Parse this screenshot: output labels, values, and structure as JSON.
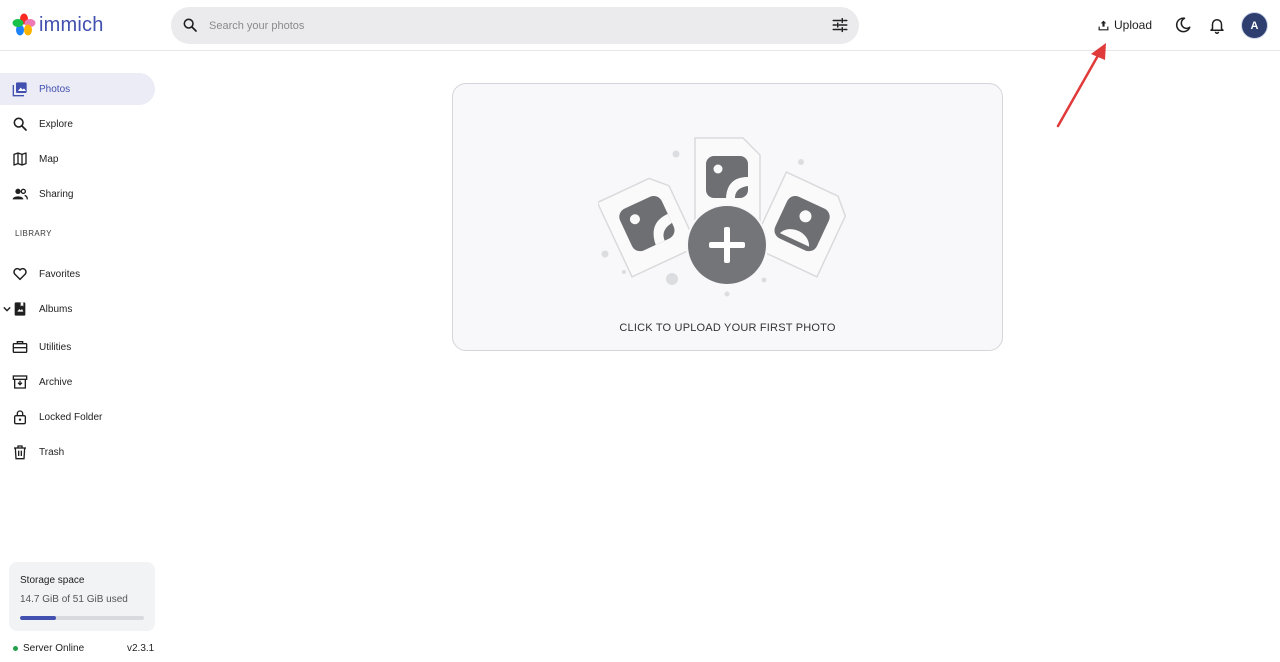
{
  "app": {
    "name": "immich",
    "brand_color": "#4250af"
  },
  "search": {
    "placeholder": "Search your photos"
  },
  "header": {
    "upload_label": "Upload",
    "avatar_initial": "A"
  },
  "sidebar": {
    "items": [
      {
        "label": "Photos",
        "icon": "photos-icon",
        "active": true
      },
      {
        "label": "Explore",
        "icon": "search-icon"
      },
      {
        "label": "Map",
        "icon": "map-icon"
      },
      {
        "label": "Sharing",
        "icon": "people-icon"
      }
    ],
    "library_label": "LIBRARY",
    "library_items": [
      {
        "label": "Favorites",
        "icon": "heart-icon"
      },
      {
        "label": "Albums",
        "icon": "album-icon",
        "expandable": true
      },
      {
        "label": "Utilities",
        "icon": "toolbox-icon"
      },
      {
        "label": "Archive",
        "icon": "archive-icon"
      },
      {
        "label": "Locked Folder",
        "icon": "lock-icon"
      },
      {
        "label": "Trash",
        "icon": "trash-icon"
      }
    ]
  },
  "storage": {
    "title": "Storage space",
    "used_text": "14.7 GiB of 51 GiB used",
    "used_fraction": 0.288
  },
  "status": {
    "server_text": "Server Online",
    "version": "v2.3.1",
    "online_color": "#22a04b"
  },
  "main": {
    "upload_caption": "CLICK TO UPLOAD YOUR FIRST PHOTO"
  },
  "annotation": {
    "arrow_color": "#e03a3a"
  }
}
